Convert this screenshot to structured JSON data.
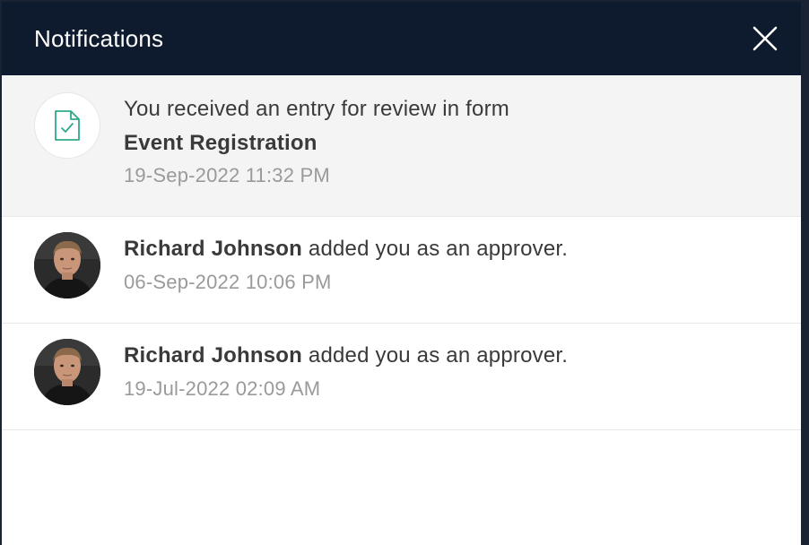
{
  "header": {
    "title": "Notifications",
    "close_icon": "close-icon"
  },
  "notifications": [
    {
      "type": "form-review",
      "icon": "form-check-icon",
      "message": "You received an entry for review in form",
      "form_name": "Event Registration",
      "timestamp": "19-Sep-2022 11:32 PM",
      "highlighted": true
    },
    {
      "type": "approver",
      "actor": "Richard Johnson",
      "message": " added you as an approver.",
      "timestamp": "06-Sep-2022 10:06 PM"
    },
    {
      "type": "approver",
      "actor": "Richard Johnson",
      "message": " added you as an approver.",
      "timestamp": "19-Jul-2022 02:09 AM"
    }
  ],
  "colors": {
    "header_bg": "#0e1a2e",
    "highlight_bg": "#f4f4f4",
    "icon_accent": "#2eaa8a"
  }
}
